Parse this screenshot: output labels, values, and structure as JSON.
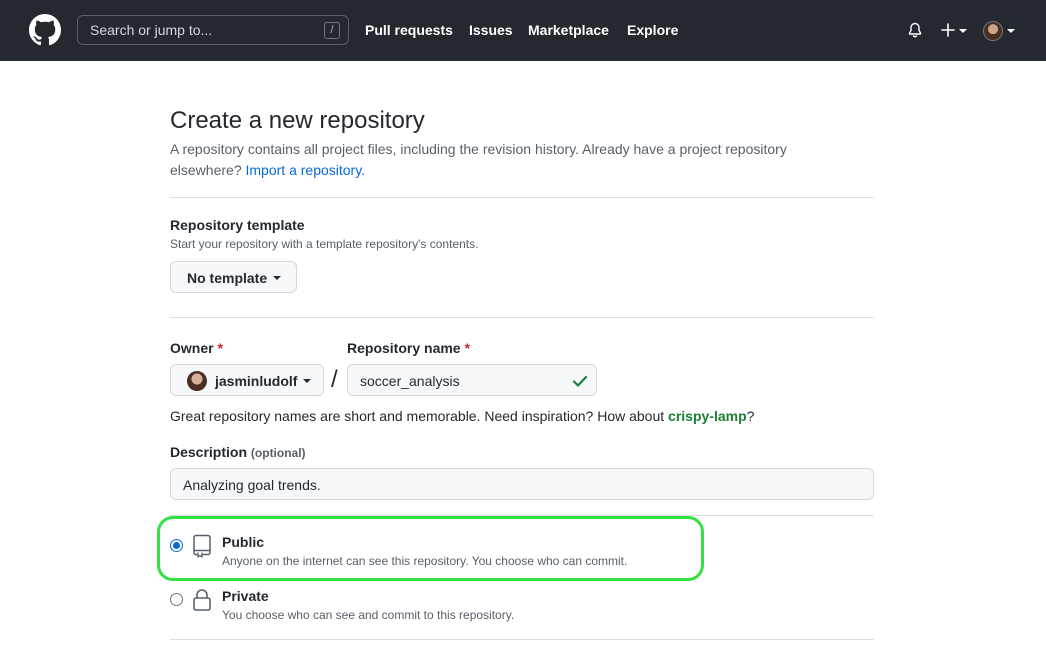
{
  "header": {
    "search_placeholder": "Search or jump to...",
    "search_shortcut": "/",
    "nav": [
      "Pull requests",
      "Issues",
      "Marketplace",
      "Explore"
    ]
  },
  "page": {
    "title": "Create a new repository",
    "subtitle": "A repository contains all project files, including the revision history. Already have a project repository elsewhere?",
    "import_link": "Import a repository."
  },
  "template": {
    "label": "Repository template",
    "note": "Start your repository with a template repository's contents.",
    "button": "No template"
  },
  "owner": {
    "label": "Owner",
    "required": "*",
    "value": "jasminludolf",
    "separator": "/"
  },
  "repo_name": {
    "label": "Repository name",
    "required": "*",
    "value": "soccer_analysis"
  },
  "helper": {
    "text": "Great repository names are short and memorable. Need inspiration? How about",
    "suggestion": "crispy-lamp",
    "end": "?"
  },
  "description": {
    "label": "Description",
    "optional": "(optional)",
    "value": "Analyzing goal trends."
  },
  "visibility": {
    "public_title": "Public",
    "public_desc": "Anyone on the internet can see this repository. You choose who can commit.",
    "private_title": "Private",
    "private_desc": "You choose who can see and commit to this repository.",
    "selected": "Public"
  },
  "colors": {
    "header_bg": "#24292f",
    "link_blue": "#0969da",
    "suggestion_green": "#1a7f37",
    "required_red": "#cf222e",
    "highlight_green": "#33e140"
  }
}
